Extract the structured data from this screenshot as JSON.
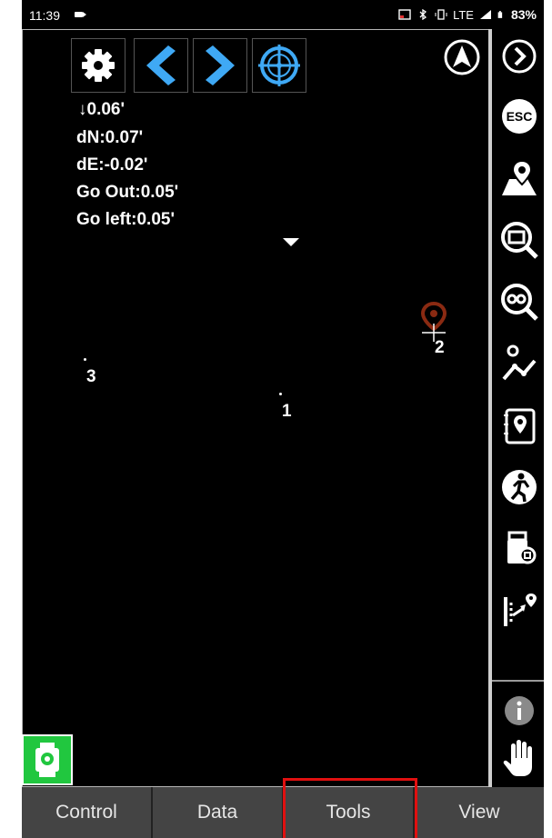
{
  "status_bar": {
    "time": "11:39",
    "network": "LTE",
    "battery": "83%"
  },
  "readout": {
    "elevation": "↓0.06'",
    "dn": "dN:0.07'",
    "de": "dE:-0.02'",
    "go_out": "Go Out:0.05'",
    "go_left": "Go left:0.05'"
  },
  "points": [
    {
      "label": "1"
    },
    {
      "label": "2"
    },
    {
      "label": "3"
    }
  ],
  "sidebar": {
    "esc_label": "ESC"
  },
  "tabs": [
    {
      "label": "Control"
    },
    {
      "label": "Data"
    },
    {
      "label": "Tools"
    },
    {
      "label": "View"
    }
  ],
  "colors": {
    "accent_blue": "#3fa9f5",
    "highlight_red": "#e01010",
    "instrument_green": "#21c73f",
    "target_brown": "#8a2a12"
  }
}
